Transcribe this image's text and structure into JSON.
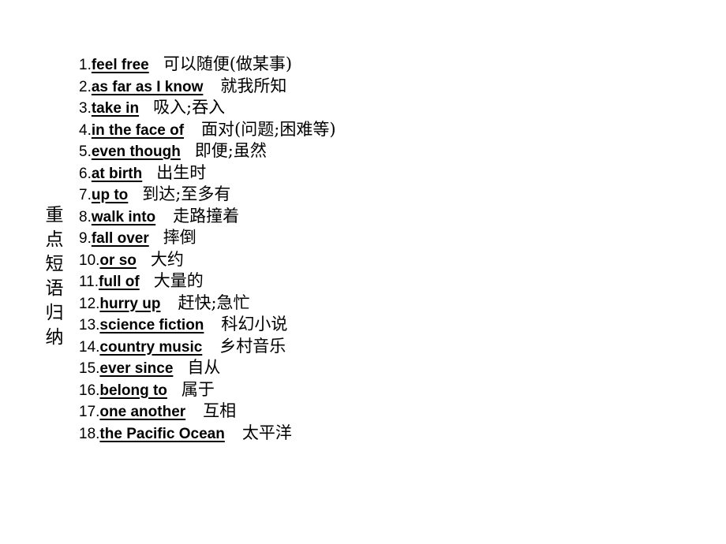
{
  "slide": {
    "background_color": "#ffffff",
    "text_color": "#000000",
    "side_label": {
      "text": "重点短语归纳",
      "characters": [
        "重",
        "点",
        "短",
        "语",
        "归",
        "纳"
      ],
      "orientation": "vertical"
    },
    "list": {
      "items": [
        {
          "number": "1.",
          "english": "feel free",
          "chinese": "可以随便(做某事)"
        },
        {
          "number": "2.",
          "english": "as far as I know",
          "chinese": "就我所知"
        },
        {
          "number": "3.",
          "english": "take in",
          "chinese": "吸入;吞入"
        },
        {
          "number": "4.",
          "english": "in the face of",
          "chinese": "面对(问题;困难等)"
        },
        {
          "number": "5.",
          "english": "even though",
          "chinese": "即便;虽然"
        },
        {
          "number": "6.",
          "english": "at birth",
          "chinese": "出生时"
        },
        {
          "number": "7.",
          "english": "up to",
          "chinese": "到达;至多有"
        },
        {
          "number": "8.",
          "english": "walk into",
          "chinese": "走路撞着"
        },
        {
          "number": "9.",
          "english": "fall over",
          "chinese": "摔倒"
        },
        {
          "number": "10.",
          "english": "or so",
          "chinese": "大约"
        },
        {
          "number": "11.",
          "english": "full of",
          "chinese": "大量的"
        },
        {
          "number": "12.",
          "english": "hurry up",
          "chinese": "赶快;急忙"
        },
        {
          "number": "13.",
          "english": "science fiction",
          "chinese": "科幻小说"
        },
        {
          "number": "14.",
          "english": "country music",
          "chinese": "乡村音乐"
        },
        {
          "number": "15.",
          "english": "ever since",
          "chinese": "自从"
        },
        {
          "number": "16.",
          "english": "belong to",
          "chinese": "属于"
        },
        {
          "number": "17.",
          "english": "one another",
          "chinese": "互相"
        },
        {
          "number": "18.",
          "english": "the Pacific Ocean",
          "chinese": "太平洋"
        }
      ]
    }
  }
}
